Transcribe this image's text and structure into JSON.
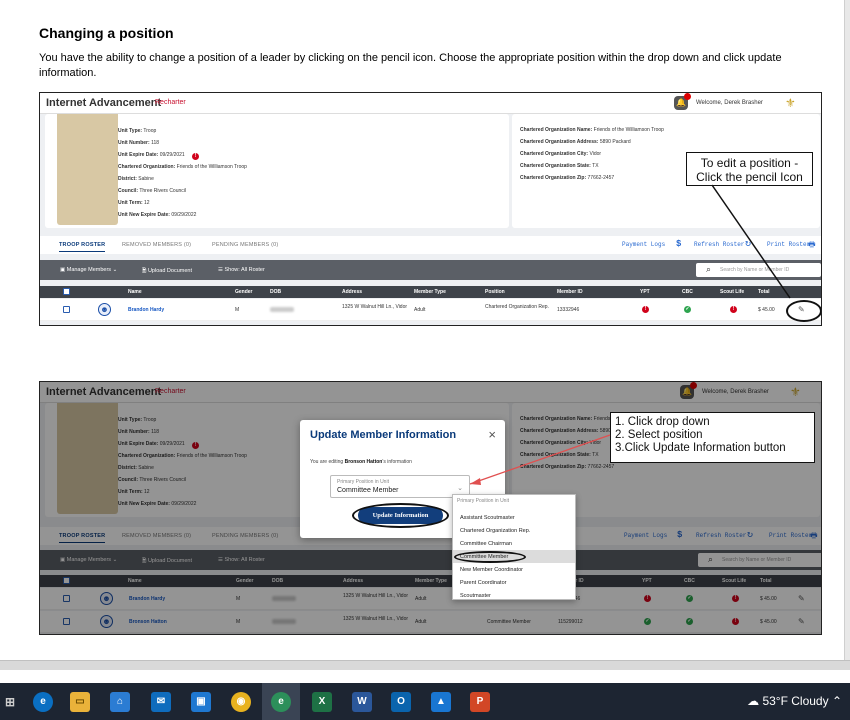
{
  "document": {
    "title": "Changing a position",
    "paragraph": "You have the ability to change a position of a leader by clicking on the pencil icon. Choose the appropriate position within the drop down and click update information."
  },
  "app": {
    "title": "Internet Advancement",
    "recharter": "Recharter",
    "welcome": "Welcome, Derek Brasher",
    "notification_count": "1"
  },
  "unit_info": {
    "unit_type": {
      "label": "Unit Type:",
      "value": "Troop"
    },
    "unit_number": {
      "label": "Unit Number:",
      "value": "118"
    },
    "unit_expire": {
      "label": "Unit Expire Date:",
      "value": "09/29/2021"
    },
    "chartered_org": {
      "label": "Chartered Organization:",
      "value": "Friends of the Williamson Troop"
    },
    "district": {
      "label": "District:",
      "value": "Sabine"
    },
    "council": {
      "label": "Council:",
      "value": "Three Rivers Council"
    },
    "unit_term": {
      "label": "Unit Term:",
      "value": "12"
    },
    "unit_new_expire": {
      "label": "Unit New Expire Date:",
      "value": "09/29/2022"
    }
  },
  "org_info": {
    "name": {
      "label": "Chartered Organization Name:",
      "value": "Friends of the Williamson Troop"
    },
    "address": {
      "label": "Chartered Organization Address:",
      "value": "5890 Packard"
    },
    "city": {
      "label": "Chartered Organization City:",
      "value": "Vidor"
    },
    "state": {
      "label": "Chartered Organization State:",
      "value": "TX"
    },
    "zip": {
      "label": "Chartered Organization Zip:",
      "value": "77662-2457"
    }
  },
  "tabs": [
    "TROOP ROSTER",
    "REMOVED MEMBERS (0)",
    "PENDING MEMBERS (0)"
  ],
  "tab_links": {
    "payment_logs": "Payment Logs",
    "refresh": "Refresh Roster",
    "print": "Print Roster"
  },
  "toolbar": {
    "manage": "Manage Members",
    "upload": "Upload Document",
    "show": "Show: All Roster",
    "search_placeholder": "Search by Name or Member ID"
  },
  "columns": [
    "Name",
    "Gender",
    "DOB",
    "Address",
    "Member Type",
    "Position",
    "Member ID",
    "YPT",
    "CBC",
    "Scout Life",
    "Total"
  ],
  "rows": [
    {
      "name": "Brandon Hardy",
      "gender": "M",
      "address": "1325 W Walnut Hill Ln., Vidor",
      "member_type": "Adult",
      "position": "Chartered Organization Rep.",
      "member_id": "13332946",
      "ypt": "red",
      "cbc": "green",
      "scout_life": "red",
      "total": "$ 45.00"
    },
    {
      "name": "Bronson Hatton",
      "gender": "M",
      "address": "1325 W Walnut Hill Ln., Vidor",
      "member_type": "Adult",
      "position": "Committee Member",
      "member_id": "115299012",
      "ypt": "green",
      "cbc": "green",
      "scout_life": "red",
      "total": "$ 45.00"
    }
  ],
  "callout1": "To edit a position -\nClick the pencil Icon",
  "modal": {
    "title": "Update Member Information",
    "close": "×",
    "desc_prefix": "You are editing ",
    "desc_name": "Bronson Hatton",
    "desc_suffix": "'s information",
    "select_label": "Primary Position in Unit",
    "select_value": "Committee Member",
    "button": "Update Information"
  },
  "dropdown": {
    "header": "Primary Position in Unit",
    "options": [
      "Assistant Scoutmaster",
      "Chartered Organization Rep.",
      "Committee Chairman",
      "Committee Member",
      "New Member Coordinator",
      "Parent Coordinator",
      "Scoutmaster"
    ],
    "selected": "Committee Member"
  },
  "callout2": "1. Click drop down\n2. Select position\n3.Click Update Information button",
  "taskbar": {
    "icons": [
      "start-icon",
      "edge-icon",
      "file-explorer-icon",
      "store-icon",
      "mail-icon",
      "media-icon",
      "chrome-icon",
      "edge-dev-icon",
      "excel-icon",
      "word-icon",
      "outlook-icon",
      "photos-icon",
      "powerpoint-icon"
    ],
    "weather": "53°F  Cloudy"
  },
  "colors": {
    "accent": "#0a3a7a",
    "link": "#1657c2",
    "alert": "#d0021b",
    "ok": "#2ea44f",
    "taskbar": "#1d2532"
  }
}
